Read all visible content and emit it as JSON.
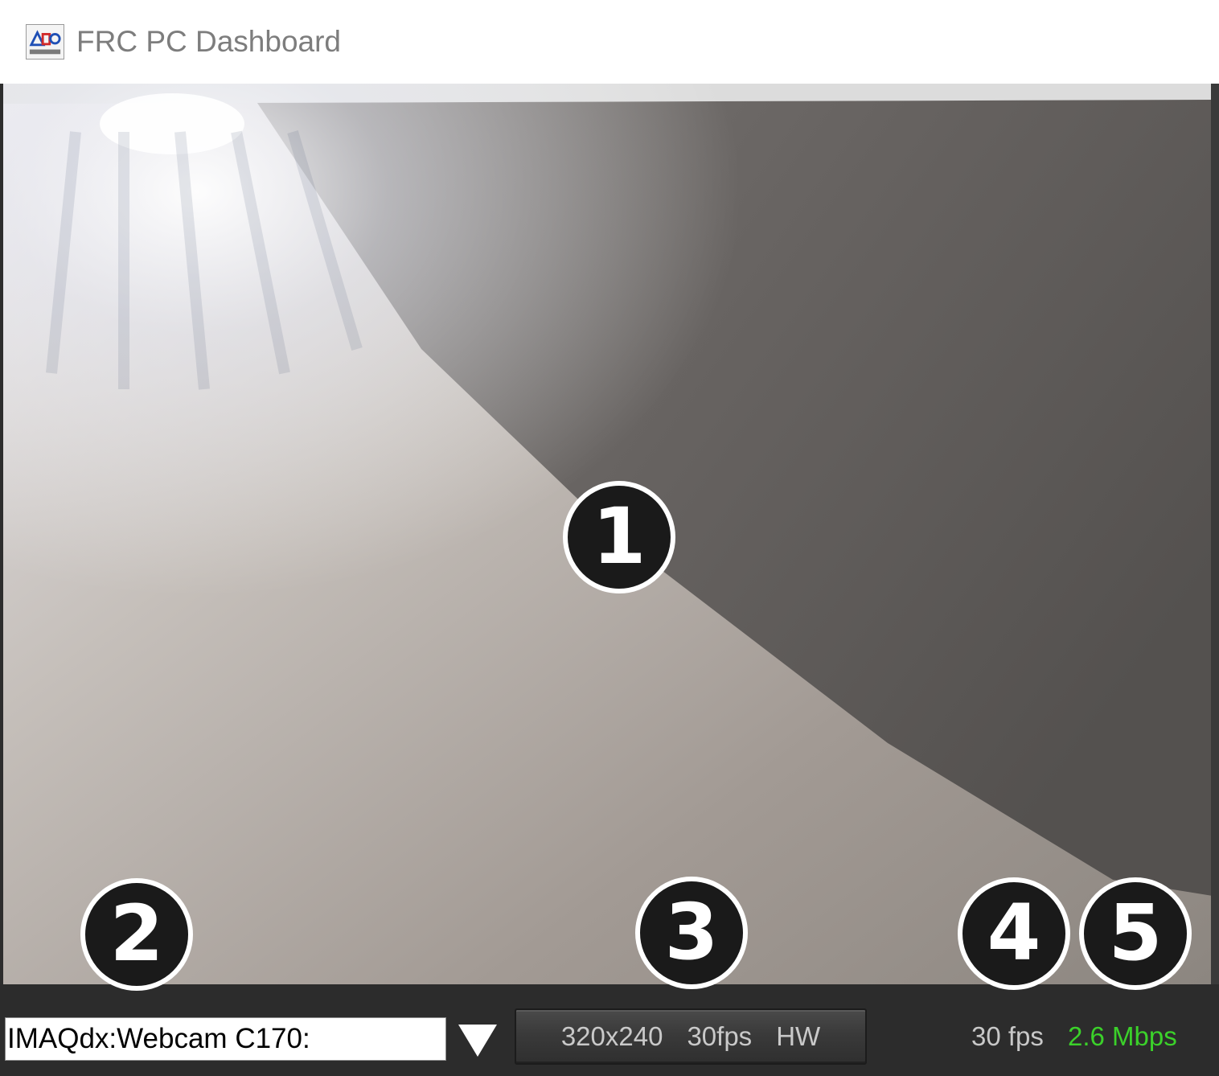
{
  "window": {
    "title": "FRC PC Dashboard",
    "icon": "frc-logo-icon"
  },
  "camera": {
    "selected_camera": "IMAQdx:Webcam C170:",
    "dropdown_icon": "triangle-down-icon",
    "settings": {
      "resolution": "320x240",
      "framerate": "30fps",
      "mode": "HW"
    },
    "fps_readout": "30 fps",
    "bandwidth_readout": "2.6 Mbps"
  },
  "callouts": [
    "1",
    "2",
    "3",
    "4",
    "5"
  ],
  "colors": {
    "bar_background": "#2c2c2c",
    "bandwidth_green": "#3bd12a",
    "fps_text": "#c8c8c8",
    "callout_fill": "#1a1a1a"
  }
}
